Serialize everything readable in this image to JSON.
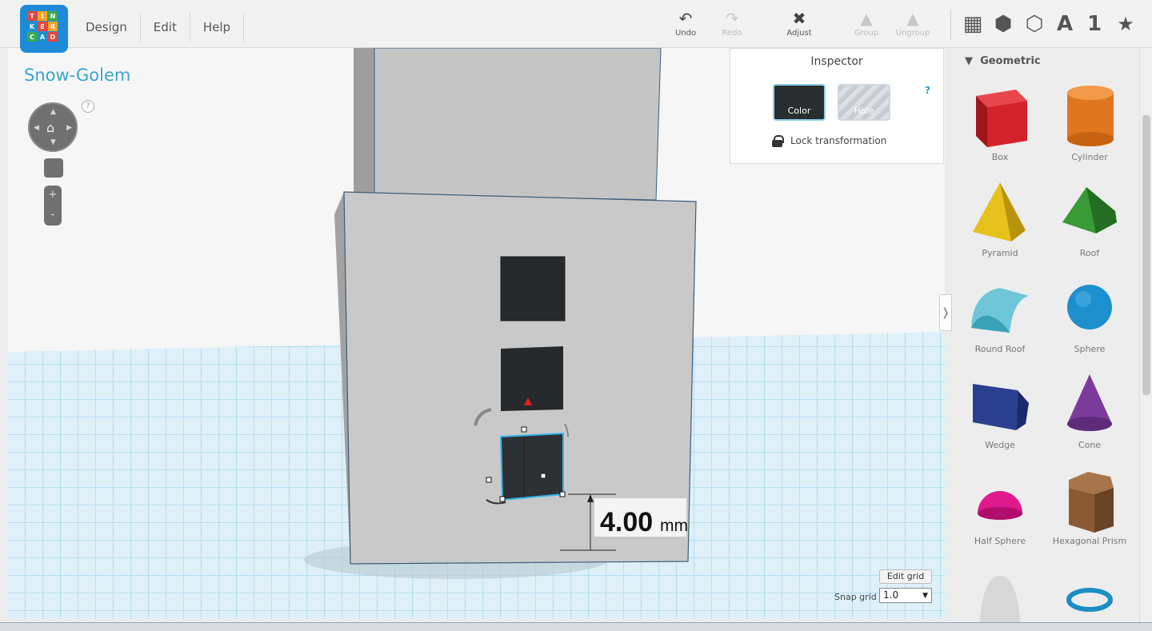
{
  "logo": {
    "letters": [
      "T",
      "I",
      "N",
      "K",
      "E",
      "R",
      "C",
      "A",
      "D"
    ]
  },
  "menu": [
    {
      "label": "Design"
    },
    {
      "label": "Edit"
    },
    {
      "label": "Help"
    }
  ],
  "toolbar": {
    "undo": {
      "label": "Undo",
      "icon": "undo-icon"
    },
    "redo": {
      "label": "Redo",
      "icon": "redo-icon"
    },
    "adjust": {
      "label": "Adjust",
      "icon": "adjust-icon"
    },
    "group": {
      "label": "Group",
      "icon": "group-icon"
    },
    "ungroup": {
      "label": "Ungroup",
      "icon": "ungroup-icon"
    }
  },
  "view_tabs": [
    {
      "icon": "workplane-grid-icon",
      "glyph": "▦"
    },
    {
      "icon": "cube-icon",
      "glyph": "⬢"
    },
    {
      "icon": "wireframe-cube-icon",
      "glyph": "⬡"
    },
    {
      "icon": "text-icon",
      "glyph": "A"
    },
    {
      "icon": "number-icon",
      "glyph": "1"
    },
    {
      "icon": "favorites-star-icon",
      "glyph": "★"
    }
  ],
  "project": {
    "title": "Snow-Golem"
  },
  "nav": {
    "help": "?",
    "zoom_in": "+",
    "zoom_out": "-"
  },
  "inspector": {
    "title": "Inspector",
    "help": "?",
    "color_label": "Color",
    "hole_label": "Hole",
    "lock_label": "Lock transformation"
  },
  "dimension": {
    "value": "4.00",
    "unit": "mm"
  },
  "grid": {
    "edit_label": "Edit grid",
    "snap_label": "Snap grid",
    "snap_value": "1.0"
  },
  "shapes_panel": {
    "category": "Geometric",
    "items": [
      {
        "label": "Box",
        "color": "#d4222b"
      },
      {
        "label": "Cylinder",
        "color": "#e0761d"
      },
      {
        "label": "Pyramid",
        "color": "#e7c11c"
      },
      {
        "label": "Roof",
        "color": "#3a9a37"
      },
      {
        "label": "Round Roof",
        "color": "#6fc6d8"
      },
      {
        "label": "Sphere",
        "color": "#1d8fcc"
      },
      {
        "label": "Wedge",
        "color": "#2a3f8f"
      },
      {
        "label": "Cone",
        "color": "#7b3b9b"
      },
      {
        "label": "Half Sphere",
        "color": "#e0198c"
      },
      {
        "label": "Hexagonal Prism",
        "color": "#8b5a34"
      },
      {
        "label": "",
        "color": "#d8d8d8"
      },
      {
        "label": "",
        "color": "#1a8ec4"
      }
    ]
  }
}
